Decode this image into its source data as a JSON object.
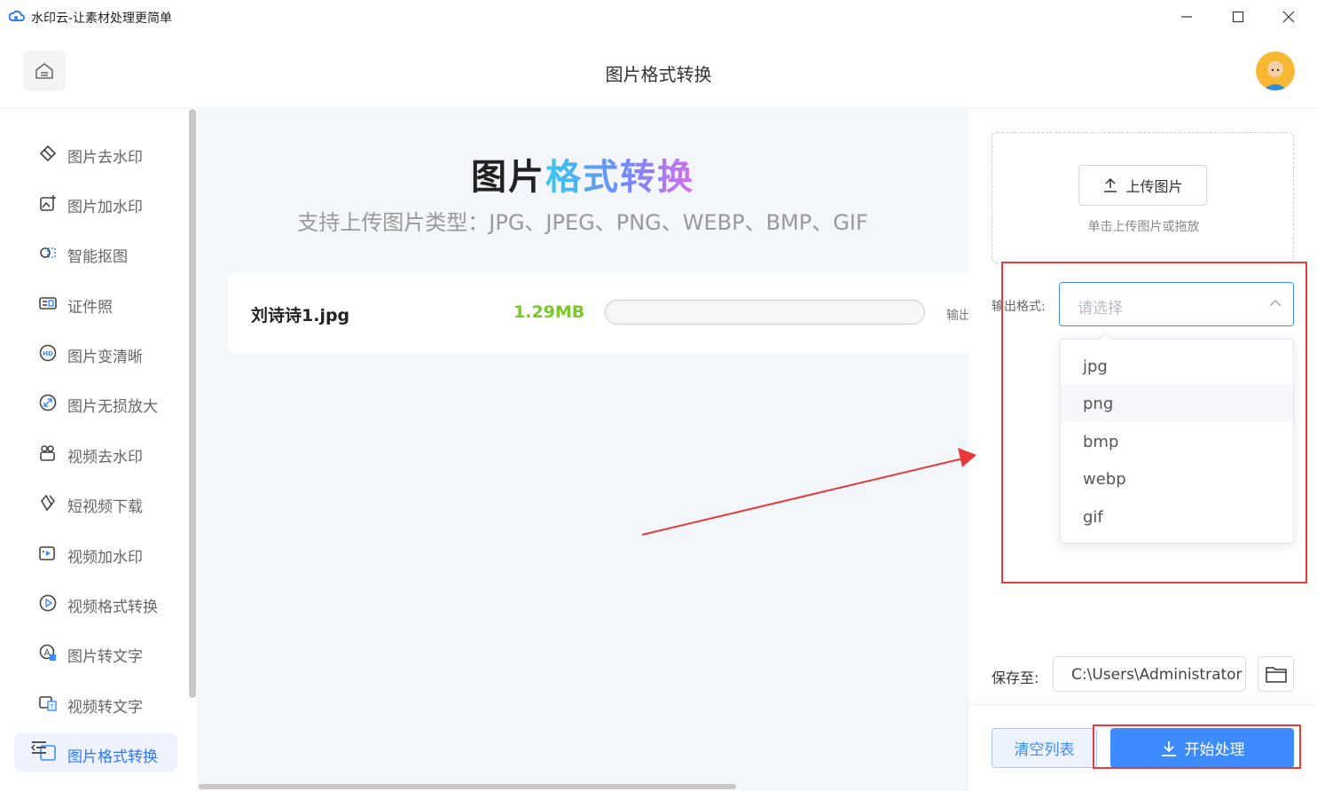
{
  "window": {
    "title": "水印云-让素材处理更简单"
  },
  "header": {
    "title": "图片格式转换"
  },
  "sidebar": {
    "items": [
      {
        "label": "图片去水印",
        "icon": "eraser-icon"
      },
      {
        "label": "图片加水印",
        "icon": "image-add-icon"
      },
      {
        "label": "智能抠图",
        "icon": "cutout-icon"
      },
      {
        "label": "证件照",
        "icon": "id-card-icon"
      },
      {
        "label": "图片变清晰",
        "icon": "hd-icon"
      },
      {
        "label": "图片无损放大",
        "icon": "enlarge-icon"
      },
      {
        "label": "视频去水印",
        "icon": "video-eraser-icon"
      },
      {
        "label": "短视频下载",
        "icon": "download-link-icon"
      },
      {
        "label": "视频加水印",
        "icon": "video-add-icon"
      },
      {
        "label": "视频格式转换",
        "icon": "video-convert-icon"
      },
      {
        "label": "图片转文字",
        "icon": "image-text-icon"
      },
      {
        "label": "视频转文字",
        "icon": "video-text-icon"
      },
      {
        "label": "图片格式转换",
        "icon": "format-convert-icon",
        "active": true
      }
    ]
  },
  "main": {
    "hero_title_part1": "图片",
    "hero_title_part2": "格式转换",
    "subtitle": "支持上传图片类型：JPG、JPEG、PNG、WEBP、BMP、GIF",
    "file": {
      "name": "刘诗诗1.jpg",
      "size": "1.29MB",
      "progress": 0,
      "output_label_partial": "输出"
    }
  },
  "panel": {
    "upload_button": "上传图片",
    "upload_hint": "单击上传图片或拖放",
    "format_label": "输出格式:",
    "format_placeholder": "请选择",
    "format_options": [
      "jpg",
      "png",
      "bmp",
      "webp",
      "gif"
    ],
    "hovered_option": "png",
    "save_label": "保存至:",
    "save_path": "C:\\Users\\Administrator",
    "clear_button": "清空列表",
    "start_button": "开始处理"
  },
  "colors": {
    "accent": "#3e8bff",
    "size_green": "#7ac72a",
    "annotation_red": "#e83a3a"
  }
}
